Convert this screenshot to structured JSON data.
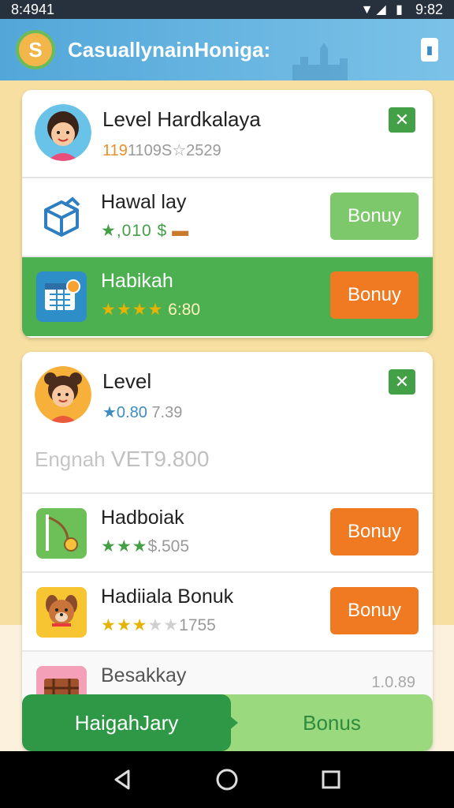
{
  "status_bar": {
    "time_left": "8:4941",
    "time_right": "9:82"
  },
  "app_bar": {
    "title": "CasuallynainHoniga:",
    "logo_letter": "S"
  },
  "card1": {
    "header": {
      "title": "Level Hardkalaya",
      "sub_highlight": "119",
      "sub_rest": "1109S☆2529"
    },
    "rows": [
      {
        "title": "Hawal lay",
        "sub": "★,010 $",
        "stars": "",
        "button": "Bonuy",
        "style": "light"
      },
      {
        "title": "Habikah",
        "stars": "★★★★",
        "sub": "6:80",
        "button": "Bonuy",
        "style": "orange"
      }
    ]
  },
  "card2": {
    "header": {
      "title": "Level",
      "sub_highlight": "★0.80",
      "sub_rest": "7.39"
    },
    "english_label": "Engnah",
    "english_value": "VET9.800",
    "rows": [
      {
        "title": "Hadboiak",
        "stars": "★★★",
        "sub": "$.505",
        "button": "Bonuy"
      },
      {
        "title": "Hadiiala Bonuk",
        "stars": "★★★",
        "dim_stars": "★★",
        "sub": "1755",
        "button": "Bonuy"
      }
    ],
    "partial_row": {
      "title": "Besakkay",
      "value": "1.0.89"
    }
  },
  "bottom_bar": {
    "left_label": "HaigahJary",
    "right_label": "Bonus"
  },
  "colors": {
    "accent_green": "#4caf50",
    "accent_orange": "#f07a22",
    "app_bar_blue": "#52a7d9",
    "background": "#f6dfa0"
  },
  "icons": {
    "status": [
      "box-icon",
      "signal-icon",
      "wifi-icon",
      "battery-icon"
    ],
    "nav": [
      "back-icon",
      "home-icon",
      "recents-icon"
    ]
  }
}
